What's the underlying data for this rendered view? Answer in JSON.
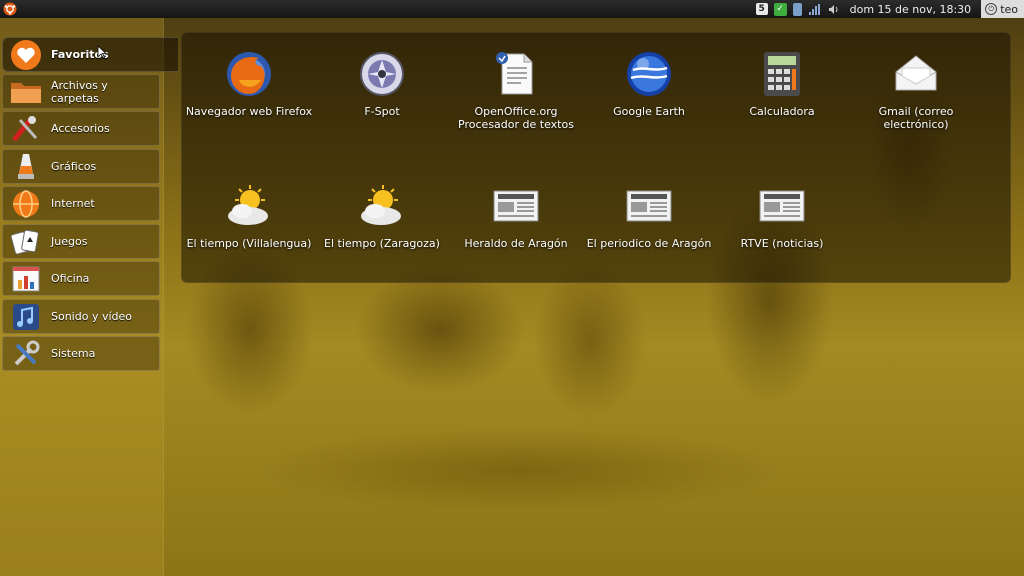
{
  "top_panel": {
    "notification_count": "5",
    "clock": "dom 15 de nov, 18:30",
    "user": "teo"
  },
  "sidebar": {
    "items": [
      {
        "label": "Favoritos",
        "icon": "heart-icon"
      },
      {
        "label": "Archivos y carpetas",
        "icon": "folder-icon"
      },
      {
        "label": "Accesorios",
        "icon": "tools-icon"
      },
      {
        "label": "Gráficos",
        "icon": "graphics-icon"
      },
      {
        "label": "Internet",
        "icon": "globe-icon"
      },
      {
        "label": "Juegos",
        "icon": "cards-icon"
      },
      {
        "label": "Oficina",
        "icon": "office-icon"
      },
      {
        "label": "Sonido y vídeo",
        "icon": "music-icon"
      },
      {
        "label": "Sistema",
        "icon": "wrench-icon"
      }
    ]
  },
  "favorites": [
    {
      "label": "Navegador web Firefox",
      "icon": "firefox-icon"
    },
    {
      "label": "F-Spot",
      "icon": "fspot-icon"
    },
    {
      "label": "OpenOffice.org Procesador de textos",
      "icon": "writer-icon"
    },
    {
      "label": "Google Earth",
      "icon": "google-earth-icon"
    },
    {
      "label": "Calculadora",
      "icon": "calculator-icon"
    },
    {
      "label": "Gmail (correo electrónico)",
      "icon": "mail-icon"
    },
    {
      "label": "El tiempo (Villalengua)",
      "icon": "weather-icon"
    },
    {
      "label": "El tiempo (Zaragoza)",
      "icon": "weather-icon"
    },
    {
      "label": "Heraldo de Aragón",
      "icon": "newspaper-icon"
    },
    {
      "label": "El periodico de Aragón",
      "icon": "newspaper-icon"
    },
    {
      "label": "RTVE (noticias)",
      "icon": "newspaper-icon"
    }
  ],
  "colors": {
    "accent_orange": "#f07a1a",
    "panel_dark": "#151515"
  }
}
